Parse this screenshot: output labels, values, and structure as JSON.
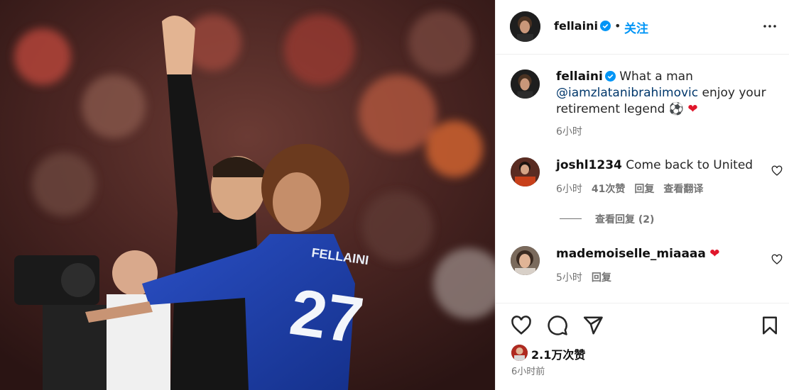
{
  "post": {
    "photo_description_icon": "photo",
    "jersey_name": "FELLAINI",
    "jersey_number": "27"
  },
  "header": {
    "username": "fellaini",
    "separator": "•",
    "follow_label": "关注",
    "more_icon": "more-horizontal-icon"
  },
  "caption": {
    "username": "fellaini",
    "text_before_mention": " What a man",
    "mention": "@iamzlatanibrahimovic",
    "text_after_mention": " enjoy your retirement legend ",
    "emoji_ball": "⚽",
    "emoji_heart": "❤",
    "time": "6小时"
  },
  "comments": [
    {
      "username": "joshl1234",
      "text": " Come back to United",
      "time": "6小时",
      "likes": "41次赞",
      "reply_label": "回复",
      "translate_label": "查看翻译",
      "view_replies_label": "查看回复 (2)"
    },
    {
      "username": "mademoiselle_miaaaa",
      "text": " ",
      "emoji": "❤",
      "time": "5小时",
      "reply_label": "回复"
    }
  ],
  "footer": {
    "likes_count": "2.1万次赞",
    "posted": "6小时前"
  },
  "colors": {
    "accent": "#0095f6",
    "mention": "#00376b",
    "muted": "#737373",
    "heart": "#e0162b",
    "jersey_blue": "#1b3ea8"
  }
}
